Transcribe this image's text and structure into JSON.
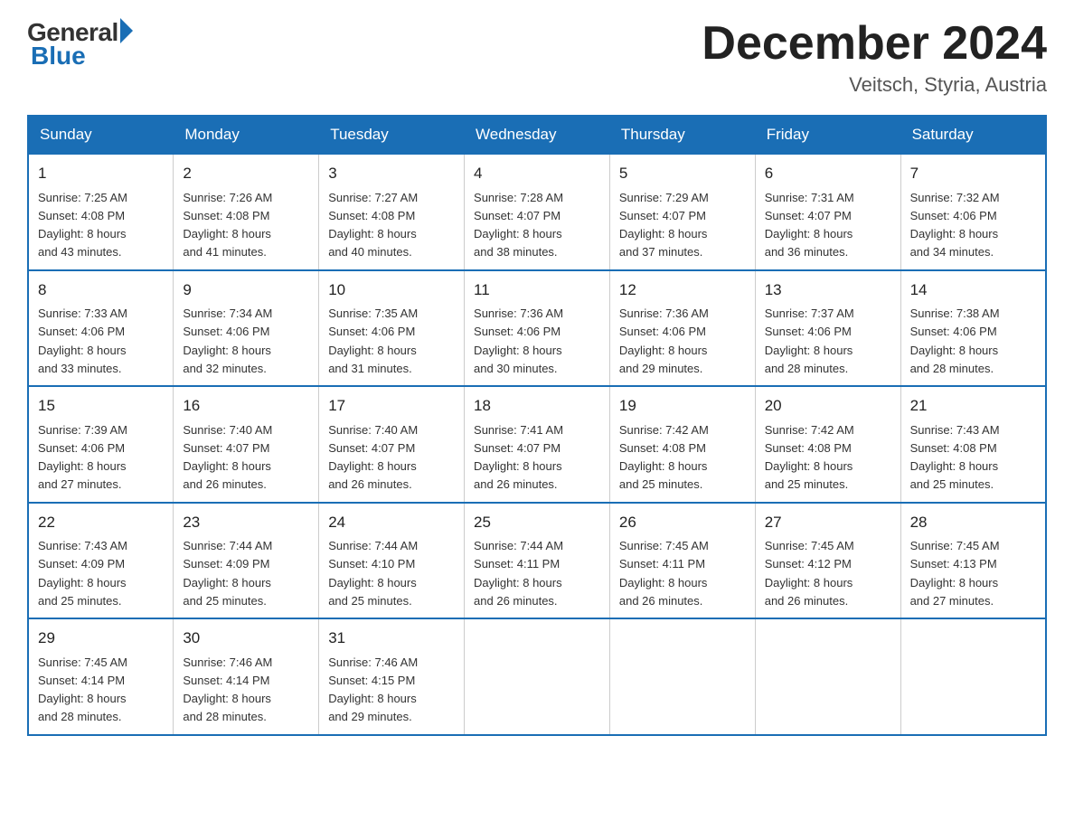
{
  "logo": {
    "general": "General",
    "blue": "Blue"
  },
  "header": {
    "title": "December 2024",
    "location": "Veitsch, Styria, Austria"
  },
  "days_of_week": [
    "Sunday",
    "Monday",
    "Tuesday",
    "Wednesday",
    "Thursday",
    "Friday",
    "Saturday"
  ],
  "weeks": [
    [
      {
        "day": "1",
        "sunrise": "7:25 AM",
        "sunset": "4:08 PM",
        "daylight": "8 hours and 43 minutes."
      },
      {
        "day": "2",
        "sunrise": "7:26 AM",
        "sunset": "4:08 PM",
        "daylight": "8 hours and 41 minutes."
      },
      {
        "day": "3",
        "sunrise": "7:27 AM",
        "sunset": "4:08 PM",
        "daylight": "8 hours and 40 minutes."
      },
      {
        "day": "4",
        "sunrise": "7:28 AM",
        "sunset": "4:07 PM",
        "daylight": "8 hours and 38 minutes."
      },
      {
        "day": "5",
        "sunrise": "7:29 AM",
        "sunset": "4:07 PM",
        "daylight": "8 hours and 37 minutes."
      },
      {
        "day": "6",
        "sunrise": "7:31 AM",
        "sunset": "4:07 PM",
        "daylight": "8 hours and 36 minutes."
      },
      {
        "day": "7",
        "sunrise": "7:32 AM",
        "sunset": "4:06 PM",
        "daylight": "8 hours and 34 minutes."
      }
    ],
    [
      {
        "day": "8",
        "sunrise": "7:33 AM",
        "sunset": "4:06 PM",
        "daylight": "8 hours and 33 minutes."
      },
      {
        "day": "9",
        "sunrise": "7:34 AM",
        "sunset": "4:06 PM",
        "daylight": "8 hours and 32 minutes."
      },
      {
        "day": "10",
        "sunrise": "7:35 AM",
        "sunset": "4:06 PM",
        "daylight": "8 hours and 31 minutes."
      },
      {
        "day": "11",
        "sunrise": "7:36 AM",
        "sunset": "4:06 PM",
        "daylight": "8 hours and 30 minutes."
      },
      {
        "day": "12",
        "sunrise": "7:36 AM",
        "sunset": "4:06 PM",
        "daylight": "8 hours and 29 minutes."
      },
      {
        "day": "13",
        "sunrise": "7:37 AM",
        "sunset": "4:06 PM",
        "daylight": "8 hours and 28 minutes."
      },
      {
        "day": "14",
        "sunrise": "7:38 AM",
        "sunset": "4:06 PM",
        "daylight": "8 hours and 28 minutes."
      }
    ],
    [
      {
        "day": "15",
        "sunrise": "7:39 AM",
        "sunset": "4:06 PM",
        "daylight": "8 hours and 27 minutes."
      },
      {
        "day": "16",
        "sunrise": "7:40 AM",
        "sunset": "4:07 PM",
        "daylight": "8 hours and 26 minutes."
      },
      {
        "day": "17",
        "sunrise": "7:40 AM",
        "sunset": "4:07 PM",
        "daylight": "8 hours and 26 minutes."
      },
      {
        "day": "18",
        "sunrise": "7:41 AM",
        "sunset": "4:07 PM",
        "daylight": "8 hours and 26 minutes."
      },
      {
        "day": "19",
        "sunrise": "7:42 AM",
        "sunset": "4:08 PM",
        "daylight": "8 hours and 25 minutes."
      },
      {
        "day": "20",
        "sunrise": "7:42 AM",
        "sunset": "4:08 PM",
        "daylight": "8 hours and 25 minutes."
      },
      {
        "day": "21",
        "sunrise": "7:43 AM",
        "sunset": "4:08 PM",
        "daylight": "8 hours and 25 minutes."
      }
    ],
    [
      {
        "day": "22",
        "sunrise": "7:43 AM",
        "sunset": "4:09 PM",
        "daylight": "8 hours and 25 minutes."
      },
      {
        "day": "23",
        "sunrise": "7:44 AM",
        "sunset": "4:09 PM",
        "daylight": "8 hours and 25 minutes."
      },
      {
        "day": "24",
        "sunrise": "7:44 AM",
        "sunset": "4:10 PM",
        "daylight": "8 hours and 25 minutes."
      },
      {
        "day": "25",
        "sunrise": "7:44 AM",
        "sunset": "4:11 PM",
        "daylight": "8 hours and 26 minutes."
      },
      {
        "day": "26",
        "sunrise": "7:45 AM",
        "sunset": "4:11 PM",
        "daylight": "8 hours and 26 minutes."
      },
      {
        "day": "27",
        "sunrise": "7:45 AM",
        "sunset": "4:12 PM",
        "daylight": "8 hours and 26 minutes."
      },
      {
        "day": "28",
        "sunrise": "7:45 AM",
        "sunset": "4:13 PM",
        "daylight": "8 hours and 27 minutes."
      }
    ],
    [
      {
        "day": "29",
        "sunrise": "7:45 AM",
        "sunset": "4:14 PM",
        "daylight": "8 hours and 28 minutes."
      },
      {
        "day": "30",
        "sunrise": "7:46 AM",
        "sunset": "4:14 PM",
        "daylight": "8 hours and 28 minutes."
      },
      {
        "day": "31",
        "sunrise": "7:46 AM",
        "sunset": "4:15 PM",
        "daylight": "8 hours and 29 minutes."
      },
      null,
      null,
      null,
      null
    ]
  ],
  "labels": {
    "sunrise": "Sunrise:",
    "sunset": "Sunset:",
    "daylight": "Daylight:"
  }
}
